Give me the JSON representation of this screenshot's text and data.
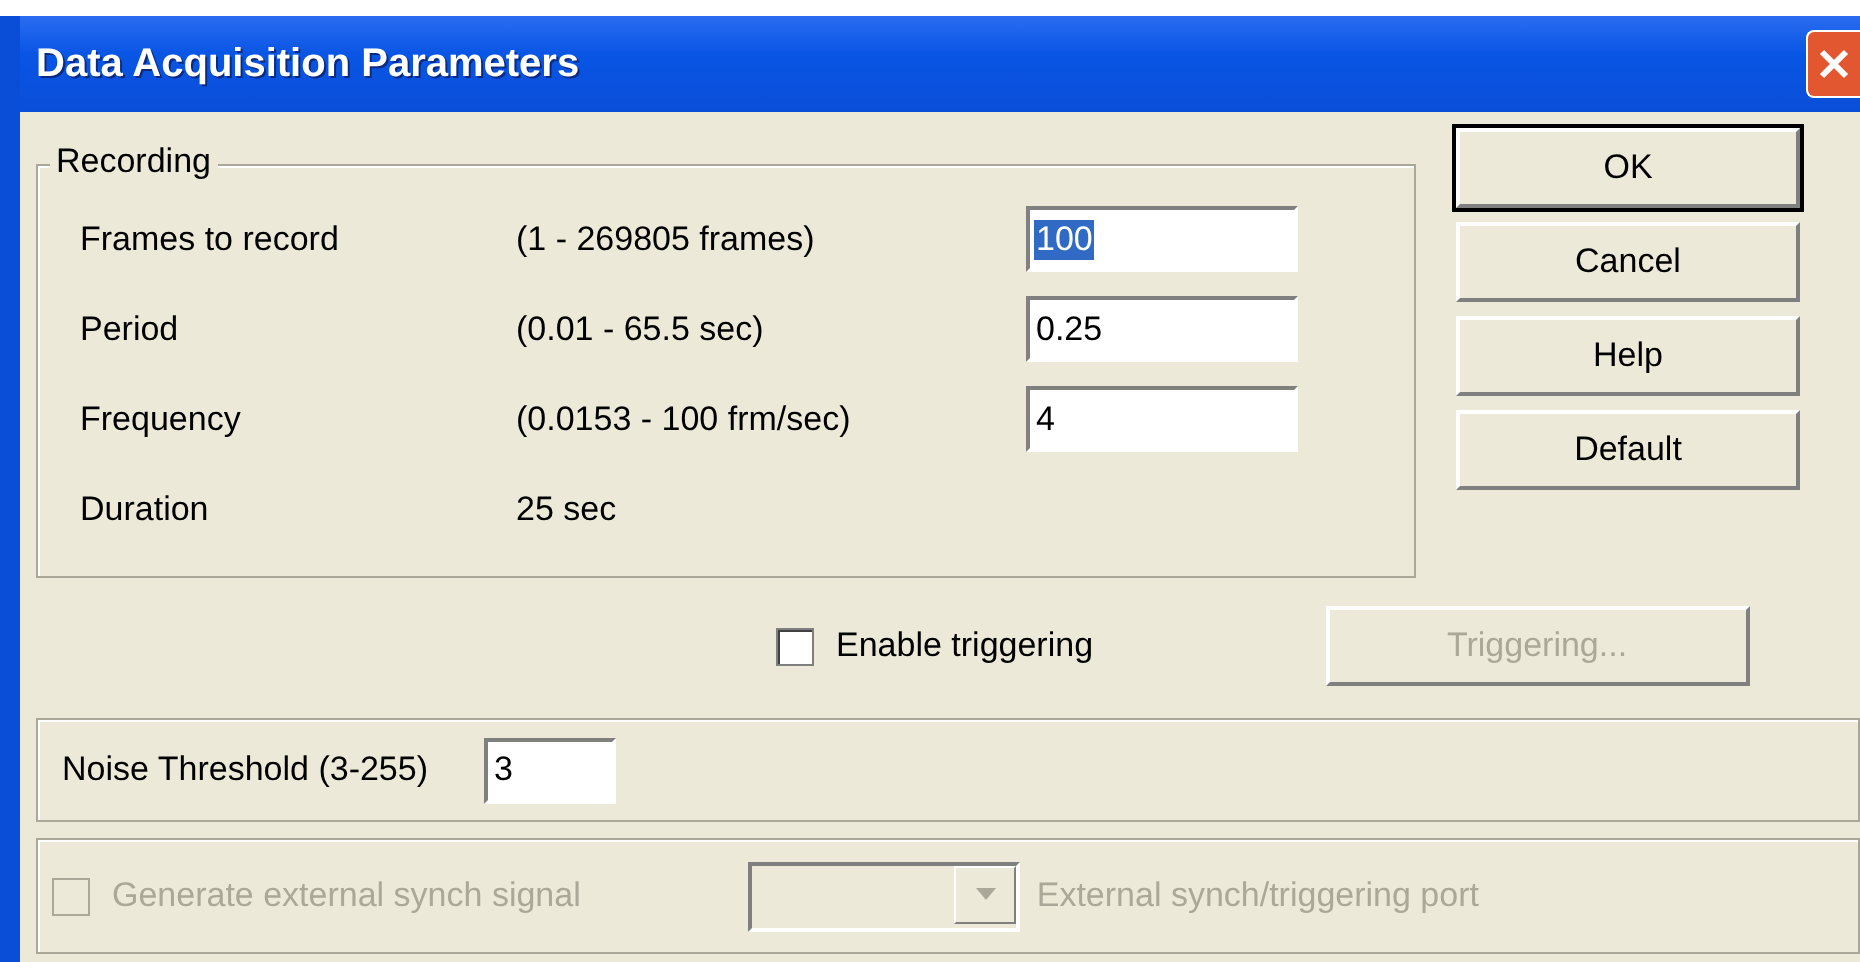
{
  "window": {
    "title": "Data Acquisition Parameters"
  },
  "recording": {
    "title": "Recording",
    "rows": [
      {
        "kind": "field",
        "label": "Frames to record",
        "range": "(1 - 269805 frames)",
        "value": "100",
        "highlighted": true
      },
      {
        "kind": "field",
        "label": "Period",
        "range": "(0.01 - 65.5 sec)",
        "value": "0.25",
        "highlighted": false
      },
      {
        "kind": "field",
        "label": "Frequency",
        "range": "(0.0153 - 100 frm/sec)",
        "value": "4",
        "highlighted": false
      },
      {
        "kind": "readout",
        "label": "Duration",
        "value": "25 sec"
      }
    ]
  },
  "buttons": [
    {
      "label": "OK",
      "default": true
    },
    {
      "label": "Cancel",
      "default": false
    },
    {
      "label": "Help",
      "default": false
    },
    {
      "label": "Default",
      "default": false
    }
  ],
  "triggering": {
    "checkbox": {
      "label": "Enable triggering",
      "checked": false,
      "disabled": false
    },
    "button": {
      "label": "Triggering...",
      "disabled": true
    }
  },
  "noise": {
    "label": "Noise Threshold (3-255)",
    "value": "3"
  },
  "external": {
    "checkbox": {
      "label": "Generate external synch signal",
      "checked": false,
      "disabled": true
    },
    "dropdown": {
      "disabled": true
    },
    "port_label": "External synch/triggering port"
  }
}
